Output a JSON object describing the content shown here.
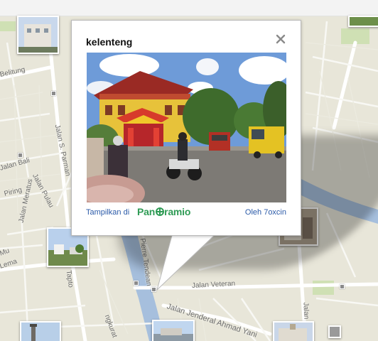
{
  "popup": {
    "title": "kelenteng",
    "close_label": "×",
    "show_in_label": "Tampilkan di",
    "brand_prefix": "Pan",
    "brand_suffix": "ramio",
    "author_label": "Oleh 7oxcin",
    "close_icon": "close-icon",
    "brand_color": "#2f9b55",
    "link_color": "#2b5aa8"
  },
  "map": {
    "background_color": "#e8e6d9",
    "road_color": "#ffffff",
    "river_color": "#a6bfdd",
    "streets": [
      "Belitung",
      "Jalan S. Parman",
      "Jalan Bali",
      "Jalan Pulau",
      "Jalan Meratus",
      "Jalan Veteran",
      "Pierre Tendean",
      "Jalan Jenderal Ahmad Yani",
      "Jalan Sirt",
      "Piring",
      "Lema",
      "Tapto",
      "Mu",
      "ngkurat"
    ]
  }
}
